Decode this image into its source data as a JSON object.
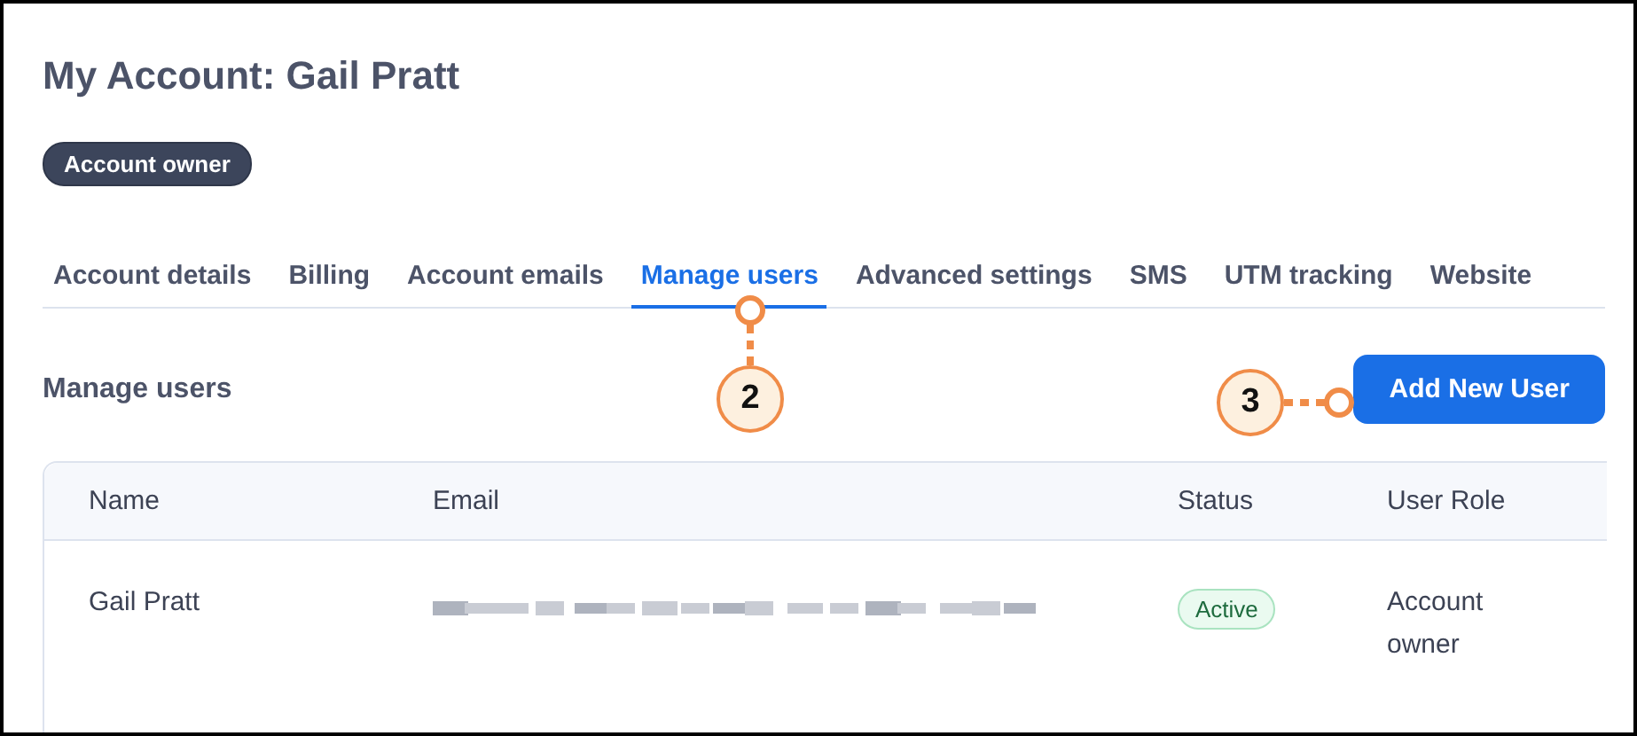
{
  "page": {
    "title": "My Account: Gail Pratt",
    "role_badge": "Account owner"
  },
  "tabs": [
    {
      "label": "Account details",
      "selected": false
    },
    {
      "label": "Billing",
      "selected": false
    },
    {
      "label": "Account emails",
      "selected": false
    },
    {
      "label": "Manage users",
      "selected": true
    },
    {
      "label": "Advanced settings",
      "selected": false
    },
    {
      "label": "SMS",
      "selected": false
    },
    {
      "label": "UTM tracking",
      "selected": false
    },
    {
      "label": "Website",
      "selected": false
    }
  ],
  "section": {
    "title": "Manage users",
    "button": "Add New User"
  },
  "table": {
    "columns": [
      "Name",
      "Email",
      "Status",
      "User Role"
    ],
    "rows": [
      {
        "name": "Gail Pratt",
        "email_blurred": true,
        "status": "Active",
        "role": "Account owner"
      }
    ]
  },
  "callouts": [
    {
      "label": "2",
      "kind": "down"
    },
    {
      "label": "3",
      "kind": "right"
    }
  ]
}
